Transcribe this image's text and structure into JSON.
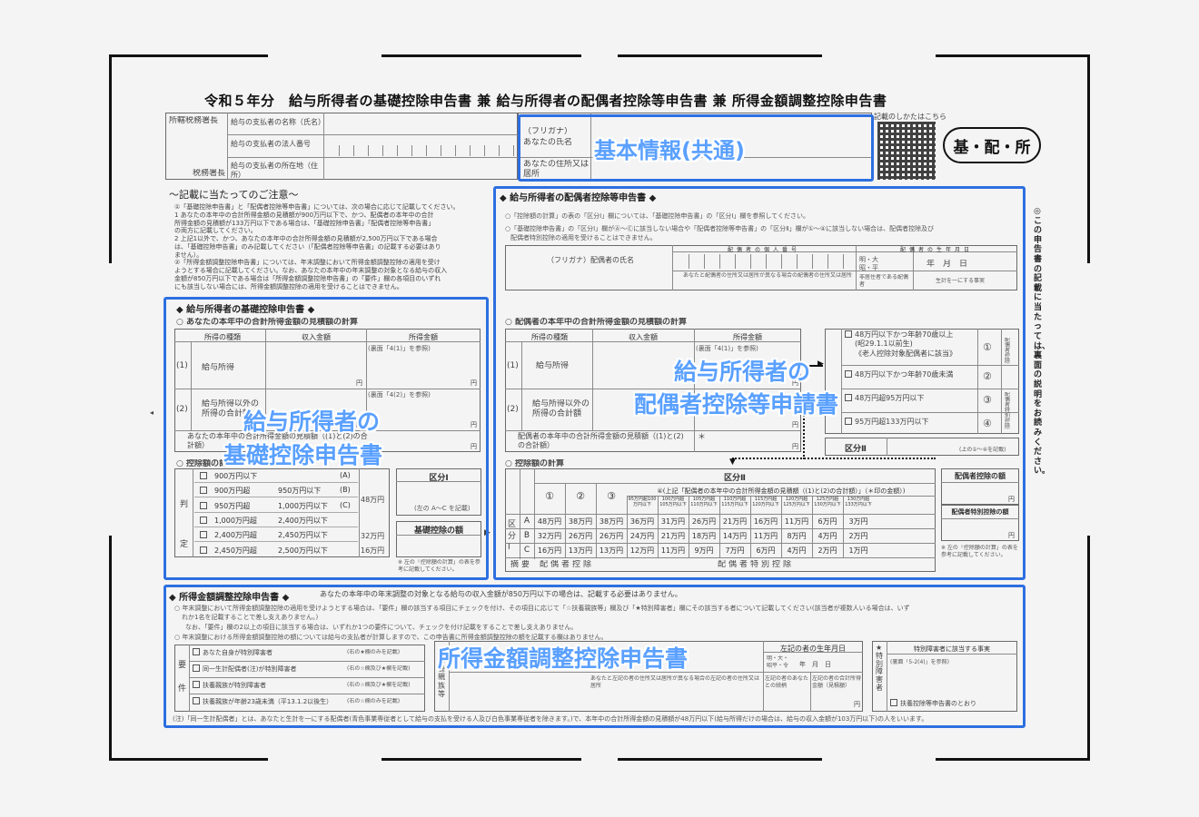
{
  "header": {
    "title": "令和５年分　給与所得者の基礎控除申告書 兼 給与所得者の配偶者控除等申告書 兼 所得金額調整控除申告書",
    "qr_caption": "記載のしかたはこちら",
    "form_badge": "基・配・所"
  },
  "top_left": {
    "office_label": "所轄税務署長",
    "tax_office_label": "税務署長",
    "payer_name": "給与の支払者の名称（氏名）",
    "payer_number": "給与の支払者の法人番号",
    "payer_address": "給与の支払者の所在地（住所）"
  },
  "basic_info": {
    "furigana": "（フリガナ）",
    "name": "あなたの氏名",
    "address": "あなたの住所又は居所",
    "highlight": "基本情報(共通)"
  },
  "notes": {
    "heading": "～記載に当たってのご注意～",
    "lines": [
      "①「基礎控除申告書」と「配偶者控除等申告書」については、次の場合に応じて記載してください。",
      "1 あなたの本年中の合計所得金額の見積額が900万円以下で、かつ、配偶者の本年中の合計",
      "所得金額の見積額が133万円以下である場合は、「基礎控除申告書」「配偶者控除等申告書」",
      "の両方に記載してください。",
      "2 上記1以外で、かつ、あなたの本年中の合計所得金額の見積額が2,500万円以下である場合",
      "は、「基礎控除申告書」のみ記載してください（「配偶者控除等申告書」の記載する必要はあり",
      "ません）。",
      "②「所得金額調整控除申告書」については、年末調整において所得金額調整控除の適用を受け",
      "ようとする場合に記載してください。なお、あなたの本年中の年末調整の対象となる給与の収入",
      "金額が850万円以下である場合は「所得金額調整控除申告書」の「要件」欄の各項目のいずれ",
      "にも該当しない場合には、所得金額調整控除の適用を受けることはできません。"
    ]
  },
  "basic_deduction": {
    "title": "◆ 給与所得者の基礎控除申告書 ◆",
    "calc_heading": "○ あなたの本年中の合計所得金額の見積額の計算",
    "cols": [
      "所得の種類",
      "収入金額",
      "所得金額"
    ],
    "row1": "給与所得",
    "row2": "給与所得以外の所得の合計額",
    "ref1": "(裏面「4(1)」を参照)",
    "ref2": "(裏面「4(2)」を参照)",
    "total": "あなたの本年中の合計所得金額の見積額（(1)と(2)の合計額）",
    "yen": "円",
    "deduction_heading": "○ 控除額の計算",
    "judge": "判定",
    "rows": [
      {
        "a": "900万円以下",
        "b": "",
        "tag": "(A)",
        "amt": "48万円"
      },
      {
        "a": "900万円超",
        "b": "950万円以下",
        "tag": "(B)",
        "amt": ""
      },
      {
        "a": "950万円超",
        "b": "1,000万円以下",
        "tag": "(C)",
        "amt": ""
      },
      {
        "a": "1,000万円超",
        "b": "2,400万円以下",
        "tag": "",
        "amt": ""
      },
      {
        "a": "2,400万円超",
        "b": "2,450万円以下",
        "tag": "",
        "amt": "32万円"
      },
      {
        "a": "2,450万円超",
        "b": "2,500万円以下",
        "tag": "",
        "amt": "16万円"
      }
    ],
    "kubun1": "区分Ⅰ",
    "kubun_note": "(左の A～C を記載)",
    "kiso_label": "基礎控除の額",
    "footnote": "※ 左の「控除額の計算」の表を参考に記載してください。",
    "highlight_l1": "給与所得者の",
    "highlight_l2": "基礎控除申告書"
  },
  "spouse_deduction": {
    "title": "◆ 給与所得者の配偶者控除等申告書 ◆",
    "info1": "○「控除額の計算」の表の「区分Ⅰ」欄については、「基礎控除申告書」の「区分Ⅰ」欄を参照してください。",
    "info2": "○「基礎控除申告書」の「区分Ⅰ」欄がⒶ～Ⓒに該当しない場合や「配偶者控除等申告書」の「区分Ⅱ」欄が①～④に該当しない場合は、配偶者控除及び",
    "info3": "配偶者特別控除の適用を受けることはできません。",
    "number_label": "配偶者の個人番号",
    "birthday_label": "配偶者の生年月日",
    "name_label": "（フリガナ）配偶者の氏名",
    "era": "明・大昭・平",
    "ym": "年　月　日",
    "address_label": "あなたと配偶者の住所又は居所が異なる場合の配偶者の住所又は居所",
    "nonres": "非居住者である配偶者",
    "same_living": "生計を一にする事実",
    "calc_heading": "○ 配偶者の本年中の合計所得金額の見積額の計算",
    "cols": [
      "所得の種類",
      "収入金額",
      "所得金額"
    ],
    "row1": "給与所得",
    "row2": "給与所得以外の所得の合計額",
    "ref1": "(裏面「4(1)」を参照)",
    "total": "配偶者の本年中の合計所得金額の見積額（(1)と(2)の合計額）",
    "star": "＊",
    "yen": "円",
    "k2_rows": [
      "48万円以下かつ年齢70歳以上",
      "(昭29.1.1以前生)",
      "《老人控除対象配偶者に該当》",
      "48万円以下かつ年齢70歳未満",
      "48万円超95万円以下",
      "95万円超133万円以下"
    ],
    "k2_nums": [
      "①",
      "②",
      "③",
      "④"
    ],
    "side1": "配偶者控除",
    "side2": "配偶者特別控除",
    "kubun2": "区分Ⅱ",
    "kubun2_note": "(上の①～④を記載)",
    "ded_heading": "○ 控除額の計算",
    "kubun_header": "区分Ⅱ",
    "sub_header": "④(上記「配偶者の本年中の合計所得金額の見積額（(1)と(2)の合計額）」（＊印の金額）)",
    "nums": [
      "①",
      "②",
      "③"
    ],
    "brackets": [
      "95万円超100万円以下",
      "100万円超105万円以下",
      "105万円超110万円以下",
      "110万円超115万円以下",
      "115万円超120万円以下",
      "120万円超125万円以下",
      "125万円超130万円以下",
      "130万円超133万円以下"
    ],
    "kubun1_label": "区分Ⅰ",
    "table": [
      {
        "k": "A",
        "v": [
          "48万円",
          "38万円",
          "38万円",
          "36万円",
          "31万円",
          "26万円",
          "21万円",
          "16万円",
          "11万円",
          "6万円",
          "3万円"
        ]
      },
      {
        "k": "B",
        "v": [
          "32万円",
          "26万円",
          "26万円",
          "24万円",
          "21万円",
          "18万円",
          "14万円",
          "11万円",
          "8万円",
          "4万円",
          "2万円"
        ]
      },
      {
        "k": "C",
        "v": [
          "16万円",
          "13万円",
          "13万円",
          "12万円",
          "11万円",
          "9万円",
          "7万円",
          "6万円",
          "4万円",
          "2万円",
          "1万円"
        ]
      }
    ],
    "summary_left": "摘要",
    "summary_mid": "配偶者控除",
    "summary_right": "配偶者特別控除",
    "ded_amt": "配偶者控除の額",
    "special_amt": "配偶者特別控除の額",
    "footnote": "※ 左の「控除額の計算」の表を参考に記載してください。",
    "highlight_l1": "給与所得者の",
    "highlight_l2": "配偶者控除等申請書"
  },
  "income_adjust": {
    "title": "◆ 所得金額調整控除申告書 ◆",
    "title_note": "あなたの本年中の年末調整の対象となる給与の収入金額が850万円以下の場合は、記載する必要はありません。",
    "info1": "○ 年末調整において所得金額調整控除の適用を受けようとする場合は、「要件」欄の該当する項目にチェックを付け、その項目に応じて「☆扶養親族等」欄及び「★特別障害者」欄にその該当する者について記載してください(該当者が複数人いる場合は、いず",
    "info2": "れか1名を記載することで差し支えありません。)",
    "info3": "なお、「要件」欄の2以上の項目に該当する場合は、いずれか1つの要件について、チェックを付け記載をすることで差し支えありません。",
    "info4": "○ 年末調整における所得金額調整控除の額については給与の支払者が計算しますので、この申告書に所得金額調整控除の額を記載する欄はありません。",
    "req": "要件",
    "req_rows": [
      {
        "label": "あなた自身が特別障害者",
        "note": "(右の★欄のみを記載)"
      },
      {
        "label": "同一生計配偶者(注)が特別障害者",
        "note": "(右の☆欄及び★欄を記載)"
      },
      {
        "label": "扶養親族が特別障害者",
        "note": "(右の☆欄及び★欄を記載)"
      },
      {
        "label": "扶養親族が年齢23歳未満（平13.1.2以後生）",
        "note": "(右の☆欄のみを記載)"
      }
    ],
    "fuyo": "扶養親族等",
    "birthday": "左記の者の生年月日",
    "era": "明・大・昭平・令",
    "ym": "年　月　日",
    "addr": "あなたと左記の者の住所又は居所が異なる場合の左記の者の住所又は居所",
    "relation": "左記の者のあなたとの続柄",
    "income": "左記の者の合計所得金額（見積額）",
    "yen": "円",
    "special": "★特別障害者",
    "special_title": "特別障害者に該当する事実",
    "special_ref": "(裏面「5-2(4)」を参照)",
    "special_cb": "扶養控除等申告書のとおり",
    "footnote": "(注)「同一生計配偶者」とは、あなたと生計を一にする配偶者(青色事業専従者として給与の支払を受ける人及び白色事業専従者を除きます。)で、本年中の合計所得金額の見積額が48万円以下(給与所得だけの場合は、給与の収入金額が103万円以下)の人をいいます。",
    "highlight": "所得金額調整控除申告書"
  },
  "right_side": {
    "text": "◎この申告書の記載に当たっては、裏面の説明をお読みください。"
  },
  "colors": {
    "accent": "#2d6fe0",
    "highlight_text": "#5aa0ff"
  }
}
